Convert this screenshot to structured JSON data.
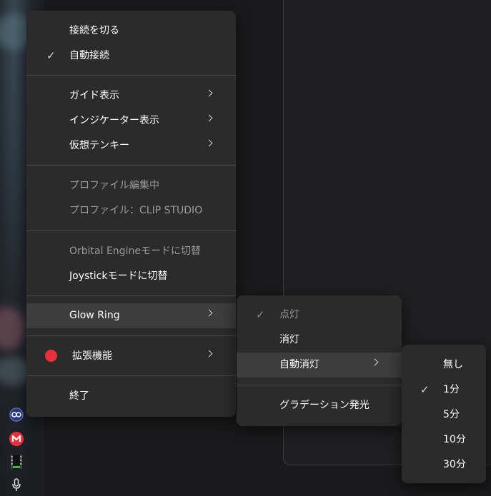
{
  "main_menu": {
    "items": [
      {
        "label": "接続を切る",
        "checked": false
      },
      {
        "label": "自動接続",
        "checked": true
      },
      {
        "label": "ガイド表示",
        "submenu": true
      },
      {
        "label": "インジケーター表示",
        "submenu": true
      },
      {
        "label": "仮想テンキー",
        "submenu": true
      },
      {
        "label": "プロファイル編集中",
        "disabled": true
      },
      {
        "label": "プロファイル：CLIP STUDIO",
        "disabled": true
      },
      {
        "label": "Orbital Engineモードに切替",
        "disabled": true
      },
      {
        "label": "Joystickモードに切替"
      },
      {
        "label": "Glow Ring",
        "submenu": true,
        "highlighted": true
      },
      {
        "label": "拡張機能",
        "submenu": true,
        "status_dot_color": "#e8303b"
      },
      {
        "label": "終了"
      }
    ]
  },
  "glow_ring_menu": {
    "items": [
      {
        "label": "点灯",
        "checked": true,
        "disabled": true
      },
      {
        "label": "消灯"
      },
      {
        "label": "自動消灯",
        "submenu": true,
        "highlighted": true
      },
      {
        "label": "グラデーション発光"
      }
    ]
  },
  "auto_off_menu": {
    "items": [
      {
        "label": "無し"
      },
      {
        "label": "1分",
        "checked": true
      },
      {
        "label": "5分"
      },
      {
        "label": "10分"
      },
      {
        "label": "30分"
      }
    ]
  },
  "tray_icons": [
    "orbital-engine-icon",
    "gmail-icon",
    "film-icon",
    "microphone-icon"
  ],
  "colors": {
    "menu_bg": "#2b2b2b",
    "highlight_bg": "#3d3d3d",
    "accent_red": "#e8303b"
  }
}
